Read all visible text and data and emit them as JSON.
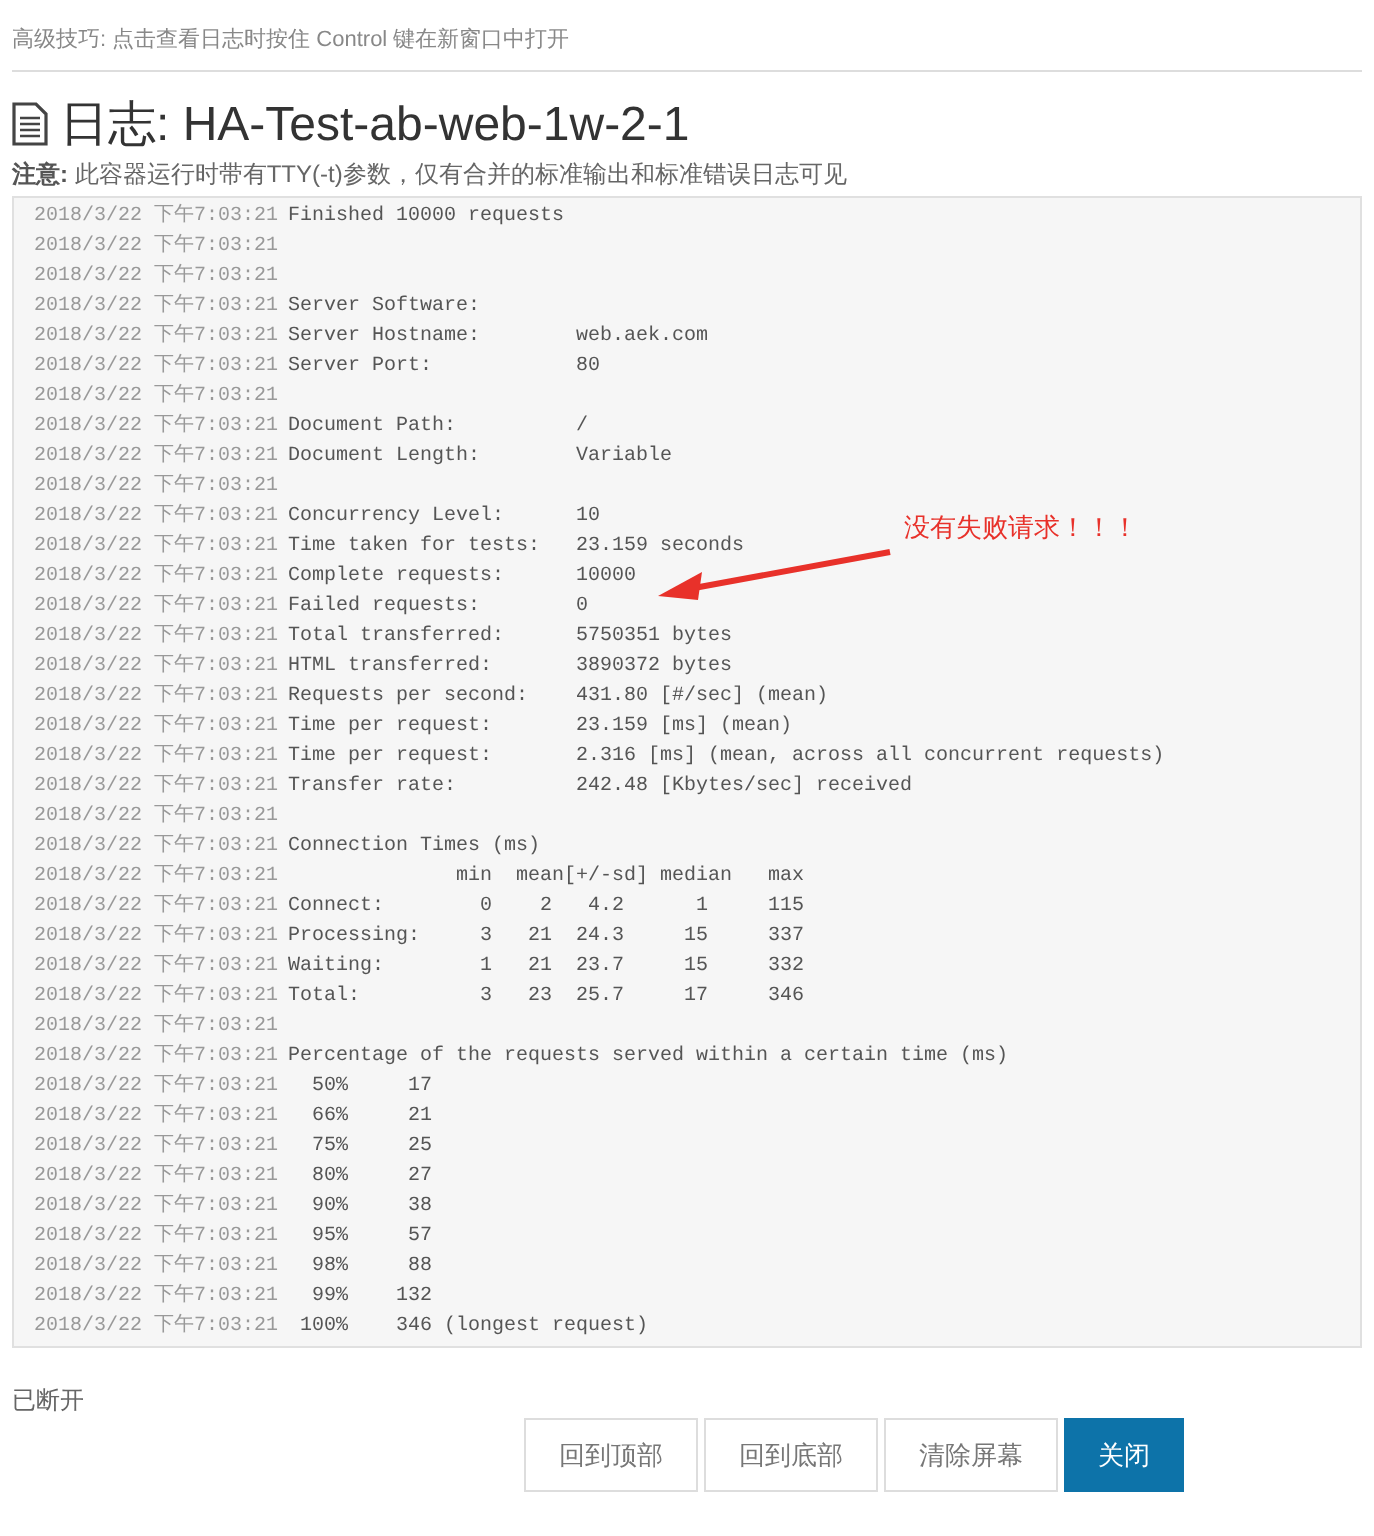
{
  "tip": "高级技巧: 点击查看日志时按住 Control 键在新窗口中打开",
  "title": "日志: HA-Test-ab-web-1w-2-1",
  "note": {
    "label": "注意:",
    "text": "此容器运行时带有TTY(-t)参数，仅有合并的标准输出和标准错误日志可见"
  },
  "log": [
    {
      "time": "2018/3/22 下午7:03:21",
      "text": "Finished 10000 requests"
    },
    {
      "time": "2018/3/22 下午7:03:21"
    },
    {
      "time": "2018/3/22 下午7:03:21"
    },
    {
      "time": "2018/3/22 下午7:03:21",
      "text": "Server Software:"
    },
    {
      "time": "2018/3/22 下午7:03:21",
      "text": "Server Hostname:        web.aek.com"
    },
    {
      "time": "2018/3/22 下午7:03:21",
      "text": "Server Port:            80"
    },
    {
      "time": "2018/3/22 下午7:03:21"
    },
    {
      "time": "2018/3/22 下午7:03:21",
      "text": "Document Path:          /"
    },
    {
      "time": "2018/3/22 下午7:03:21",
      "text": "Document Length:        Variable"
    },
    {
      "time": "2018/3/22 下午7:03:21"
    },
    {
      "time": "2018/3/22 下午7:03:21",
      "text": "Concurrency Level:      10"
    },
    {
      "time": "2018/3/22 下午7:03:21",
      "text": "Time taken for tests:   23.159 seconds"
    },
    {
      "time": "2018/3/22 下午7:03:21",
      "text": "Complete requests:      10000"
    },
    {
      "time": "2018/3/22 下午7:03:21",
      "text": "Failed requests:        0"
    },
    {
      "time": "2018/3/22 下午7:03:21",
      "text": "Total transferred:      5750351 bytes"
    },
    {
      "time": "2018/3/22 下午7:03:21",
      "text": "HTML transferred:       3890372 bytes"
    },
    {
      "time": "2018/3/22 下午7:03:21",
      "text": "Requests per second:    431.80 [#/sec] (mean)"
    },
    {
      "time": "2018/3/22 下午7:03:21",
      "text": "Time per request:       23.159 [ms] (mean)"
    },
    {
      "time": "2018/3/22 下午7:03:21",
      "text": "Time per request:       2.316 [ms] (mean, across all concurrent requests)"
    },
    {
      "time": "2018/3/22 下午7:03:21",
      "text": "Transfer rate:          242.48 [Kbytes/sec] received"
    },
    {
      "time": "2018/3/22 下午7:03:21"
    },
    {
      "time": "2018/3/22 下午7:03:21",
      "text": "Connection Times (ms)"
    },
    {
      "time": "2018/3/22 下午7:03:21",
      "text": "              min  mean[+/-sd] median   max"
    },
    {
      "time": "2018/3/22 下午7:03:21",
      "text": "Connect:        0    2   4.2      1     115"
    },
    {
      "time": "2018/3/22 下午7:03:21",
      "text": "Processing:     3   21  24.3     15     337"
    },
    {
      "time": "2018/3/22 下午7:03:21",
      "text": "Waiting:        1   21  23.7     15     332"
    },
    {
      "time": "2018/3/22 下午7:03:21",
      "text": "Total:          3   23  25.7     17     346"
    },
    {
      "time": "2018/3/22 下午7:03:21"
    },
    {
      "time": "2018/3/22 下午7:03:21",
      "text": "Percentage of the requests served within a certain time (ms)"
    },
    {
      "time": "2018/3/22 下午7:03:21",
      "text": "  50%     17"
    },
    {
      "time": "2018/3/22 下午7:03:21",
      "text": "  66%     21"
    },
    {
      "time": "2018/3/22 下午7:03:21",
      "text": "  75%     25"
    },
    {
      "time": "2018/3/22 下午7:03:21",
      "text": "  80%     27"
    },
    {
      "time": "2018/3/22 下午7:03:21",
      "text": "  90%     38"
    },
    {
      "time": "2018/3/22 下午7:03:21",
      "text": "  95%     57"
    },
    {
      "time": "2018/3/22 下午7:03:21",
      "text": "  98%     88"
    },
    {
      "time": "2018/3/22 下午7:03:21",
      "text": "  99%    132"
    },
    {
      "time": "2018/3/22 下午7:03:21",
      "text": " 100%    346 (longest request)"
    }
  ],
  "annotation": {
    "text": "没有失败请求！！！"
  },
  "status": "已断开",
  "buttons": [
    {
      "label": "回到顶部",
      "primary": false
    },
    {
      "label": "回到底部",
      "primary": false
    },
    {
      "label": "清除屏幕",
      "primary": false
    },
    {
      "label": "关闭",
      "primary": true
    }
  ]
}
